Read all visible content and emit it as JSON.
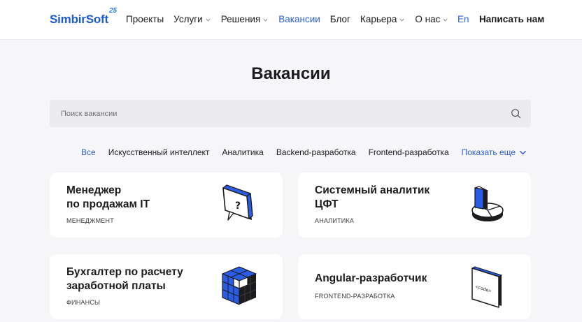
{
  "header": {
    "logo": "SimbirSoft",
    "logo_badge": "25",
    "nav": [
      {
        "label": "Проекты",
        "dropdown": false,
        "active": false
      },
      {
        "label": "Услуги",
        "dropdown": true,
        "active": false
      },
      {
        "label": "Решения",
        "dropdown": true,
        "active": false
      },
      {
        "label": "Вакансии",
        "dropdown": false,
        "active": true
      },
      {
        "label": "Блог",
        "dropdown": false,
        "active": false
      },
      {
        "label": "Карьера",
        "dropdown": true,
        "active": false
      },
      {
        "label": "О нас",
        "dropdown": true,
        "active": false
      }
    ],
    "lang": "En",
    "cta": "Написать нам"
  },
  "main": {
    "title": "Вакансии",
    "search": {
      "placeholder": "Поиск вакансии",
      "value": ""
    },
    "filters": [
      {
        "label": "Все",
        "active": true
      },
      {
        "label": "Искусственный интеллект",
        "active": false
      },
      {
        "label": "Аналитика",
        "active": false
      },
      {
        "label": "Backend-разработка",
        "active": false
      },
      {
        "label": "Frontend-разработка",
        "active": false
      }
    ],
    "show_more": "Показать еще",
    "cards": [
      {
        "title": "Менеджер\nпо продажам IT",
        "category": "МЕНЕДЖМЕНТ",
        "icon": "question-chat-icon"
      },
      {
        "title": "Системный аналитик\nЦФТ",
        "category": "АНАЛИТИКА",
        "icon": "pie-chart-icon"
      },
      {
        "title": "Бухгалтер по расчету\nзаработной платы",
        "category": "ФИНАНСЫ",
        "icon": "cube-blocks-icon"
      },
      {
        "title": "Angular-разработчик",
        "category": "FRONTEND-РАЗРАБОТКА",
        "icon": "code-screen-icon",
        "code_label": "<code>"
      }
    ]
  },
  "colors": {
    "accent": "#2a5fd3",
    "brand_blue": "#1d5bd6",
    "page_bg": "#f6f6f8",
    "card_bg": "#ffffff"
  }
}
